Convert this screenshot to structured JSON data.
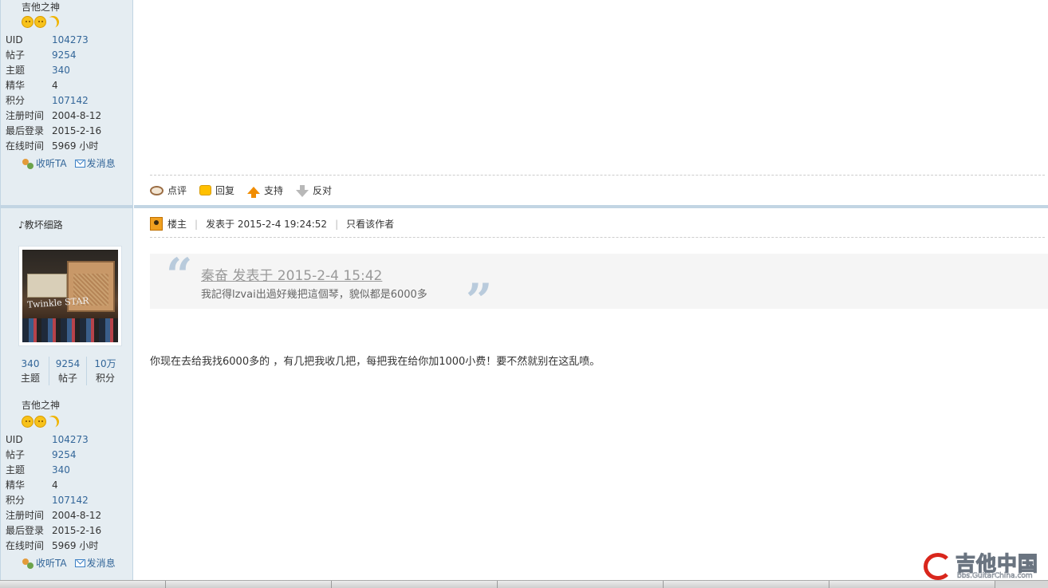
{
  "profile_top": {
    "rank_title": "吉他之神",
    "stats": [
      {
        "label": "UID",
        "value": "104273",
        "link": true
      },
      {
        "label": "帖子",
        "value": "9254",
        "link": true
      },
      {
        "label": "主题",
        "value": "340",
        "link": true
      },
      {
        "label": "精华",
        "value": "4",
        "link": false
      },
      {
        "label": "积分",
        "value": "107142",
        "link": true
      },
      {
        "label": "注册时间",
        "value": "2004-8-12",
        "link": false
      },
      {
        "label": "最后登录",
        "value": "2015-2-16",
        "link": false
      },
      {
        "label": "在线时间",
        "value": "5969 小时",
        "link": false
      }
    ],
    "follow_label": "收听TA",
    "message_label": "发消息"
  },
  "post_toolbar": {
    "comment_label": "点评",
    "reply_label": "回复",
    "support_label": "支持",
    "oppose_label": "反对"
  },
  "profile_bottom": {
    "username": "♪教坏细路",
    "avatar_text": "Twinkle STAR",
    "mini_stats": [
      {
        "value": "340",
        "label": "主题"
      },
      {
        "value": "9254",
        "label": "帖子"
      },
      {
        "value": "10万",
        "label": "积分"
      }
    ],
    "rank_title": "吉他之神",
    "stats": [
      {
        "label": "UID",
        "value": "104273"
      },
      {
        "label": "帖子",
        "value": "9254"
      },
      {
        "label": "主题",
        "value": "340"
      },
      {
        "label": "精华",
        "value": "4"
      },
      {
        "label": "积分",
        "value": "107142"
      },
      {
        "label": "注册时间",
        "value": "2004-8-12"
      },
      {
        "label": "最后登录",
        "value": "2015-2-16"
      },
      {
        "label": "在线时间",
        "value": "5969 小时"
      }
    ],
    "follow_label": "收听TA",
    "message_label": "发消息"
  },
  "post": {
    "owner_label": "楼主",
    "posted_at": "发表于 2015-2-4 19:24:52",
    "only_author_label": "只看该作者",
    "quote_header": "秦奋 发表于 2015-2-4 15:42",
    "quote_body": "我記得lzvai出過好幾把這個琴，貌似都是6000多",
    "body": "你现在去给我找6000多的 ，有几把我收几把，每把我在给你加1000小费！要不然就别在这乱喷。"
  },
  "watermark": {
    "title": "吉他中国",
    "url": "bbs.GuitarChina.com"
  }
}
